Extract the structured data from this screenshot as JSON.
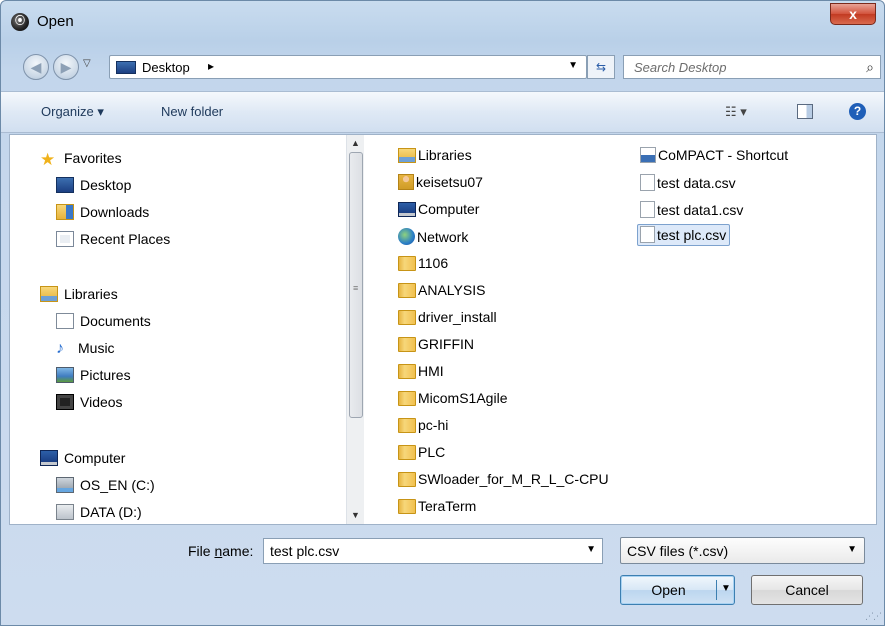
{
  "window": {
    "title": "Open",
    "close_label": "x"
  },
  "address": {
    "location": "Desktop",
    "separator": "▸",
    "search_placeholder": "Search Desktop"
  },
  "toolbar": {
    "organize_label": "Organize ▾",
    "new_folder_label": "New folder",
    "views_label": "☷ ▾",
    "help_label": "?"
  },
  "nav": {
    "items": [
      {
        "label": "Favorites",
        "icon": "star-icon"
      },
      {
        "label": "Desktop",
        "icon": "desktop-icon"
      },
      {
        "label": "Downloads",
        "icon": "downloads-icon"
      },
      {
        "label": "Recent Places",
        "icon": "recent-places-icon"
      },
      {
        "label": "Libraries",
        "icon": "libraries-icon"
      },
      {
        "label": "Documents",
        "icon": "documents-icon"
      },
      {
        "label": "Music",
        "icon": "music-icon"
      },
      {
        "label": "Pictures",
        "icon": "pictures-icon"
      },
      {
        "label": "Videos",
        "icon": "videos-icon"
      },
      {
        "label": "Computer",
        "icon": "computer-icon"
      },
      {
        "label": "OS_EN (C:)",
        "icon": "os-drive-icon"
      },
      {
        "label": "DATA (D:)",
        "icon": "drive-icon"
      }
    ]
  },
  "files": {
    "column1": [
      {
        "label": "Libraries",
        "icon": "libraries-icon"
      },
      {
        "label": "keisetsu07",
        "icon": "user-folder-icon"
      },
      {
        "label": "Computer",
        "icon": "computer-icon"
      },
      {
        "label": "Network",
        "icon": "network-icon"
      },
      {
        "label": "1106",
        "icon": "folder-icon"
      },
      {
        "label": "ANALYSIS",
        "icon": "folder-icon"
      },
      {
        "label": "driver_install",
        "icon": "folder-icon"
      },
      {
        "label": "GRIFFIN",
        "icon": "folder-icon"
      },
      {
        "label": "HMI",
        "icon": "folder-icon"
      },
      {
        "label": "MicomS1Agile",
        "icon": "folder-icon"
      },
      {
        "label": "pc-hi",
        "icon": "folder-icon"
      },
      {
        "label": "PLC",
        "icon": "folder-icon"
      },
      {
        "label": "SWloader_for_M_R_L_C-CPU",
        "icon": "folder-icon"
      },
      {
        "label": "TeraTerm",
        "icon": "folder-icon"
      }
    ],
    "column2": [
      {
        "label": "CoMPACT - Shortcut",
        "icon": "shortcut-icon"
      },
      {
        "label": "test data.csv",
        "icon": "csv-file-icon"
      },
      {
        "label": "test data1.csv",
        "icon": "csv-file-icon"
      },
      {
        "label": "test plc.csv",
        "icon": "csv-file-icon",
        "selected": true
      }
    ]
  },
  "bottom": {
    "file_name_label_prefix": "File ",
    "file_name_label_accel": "n",
    "file_name_label_suffix": "ame:",
    "file_name_value": "test plc.csv",
    "filter_value": "CSV files (*.csv)",
    "open_label": "Open",
    "cancel_label": "Cancel"
  }
}
